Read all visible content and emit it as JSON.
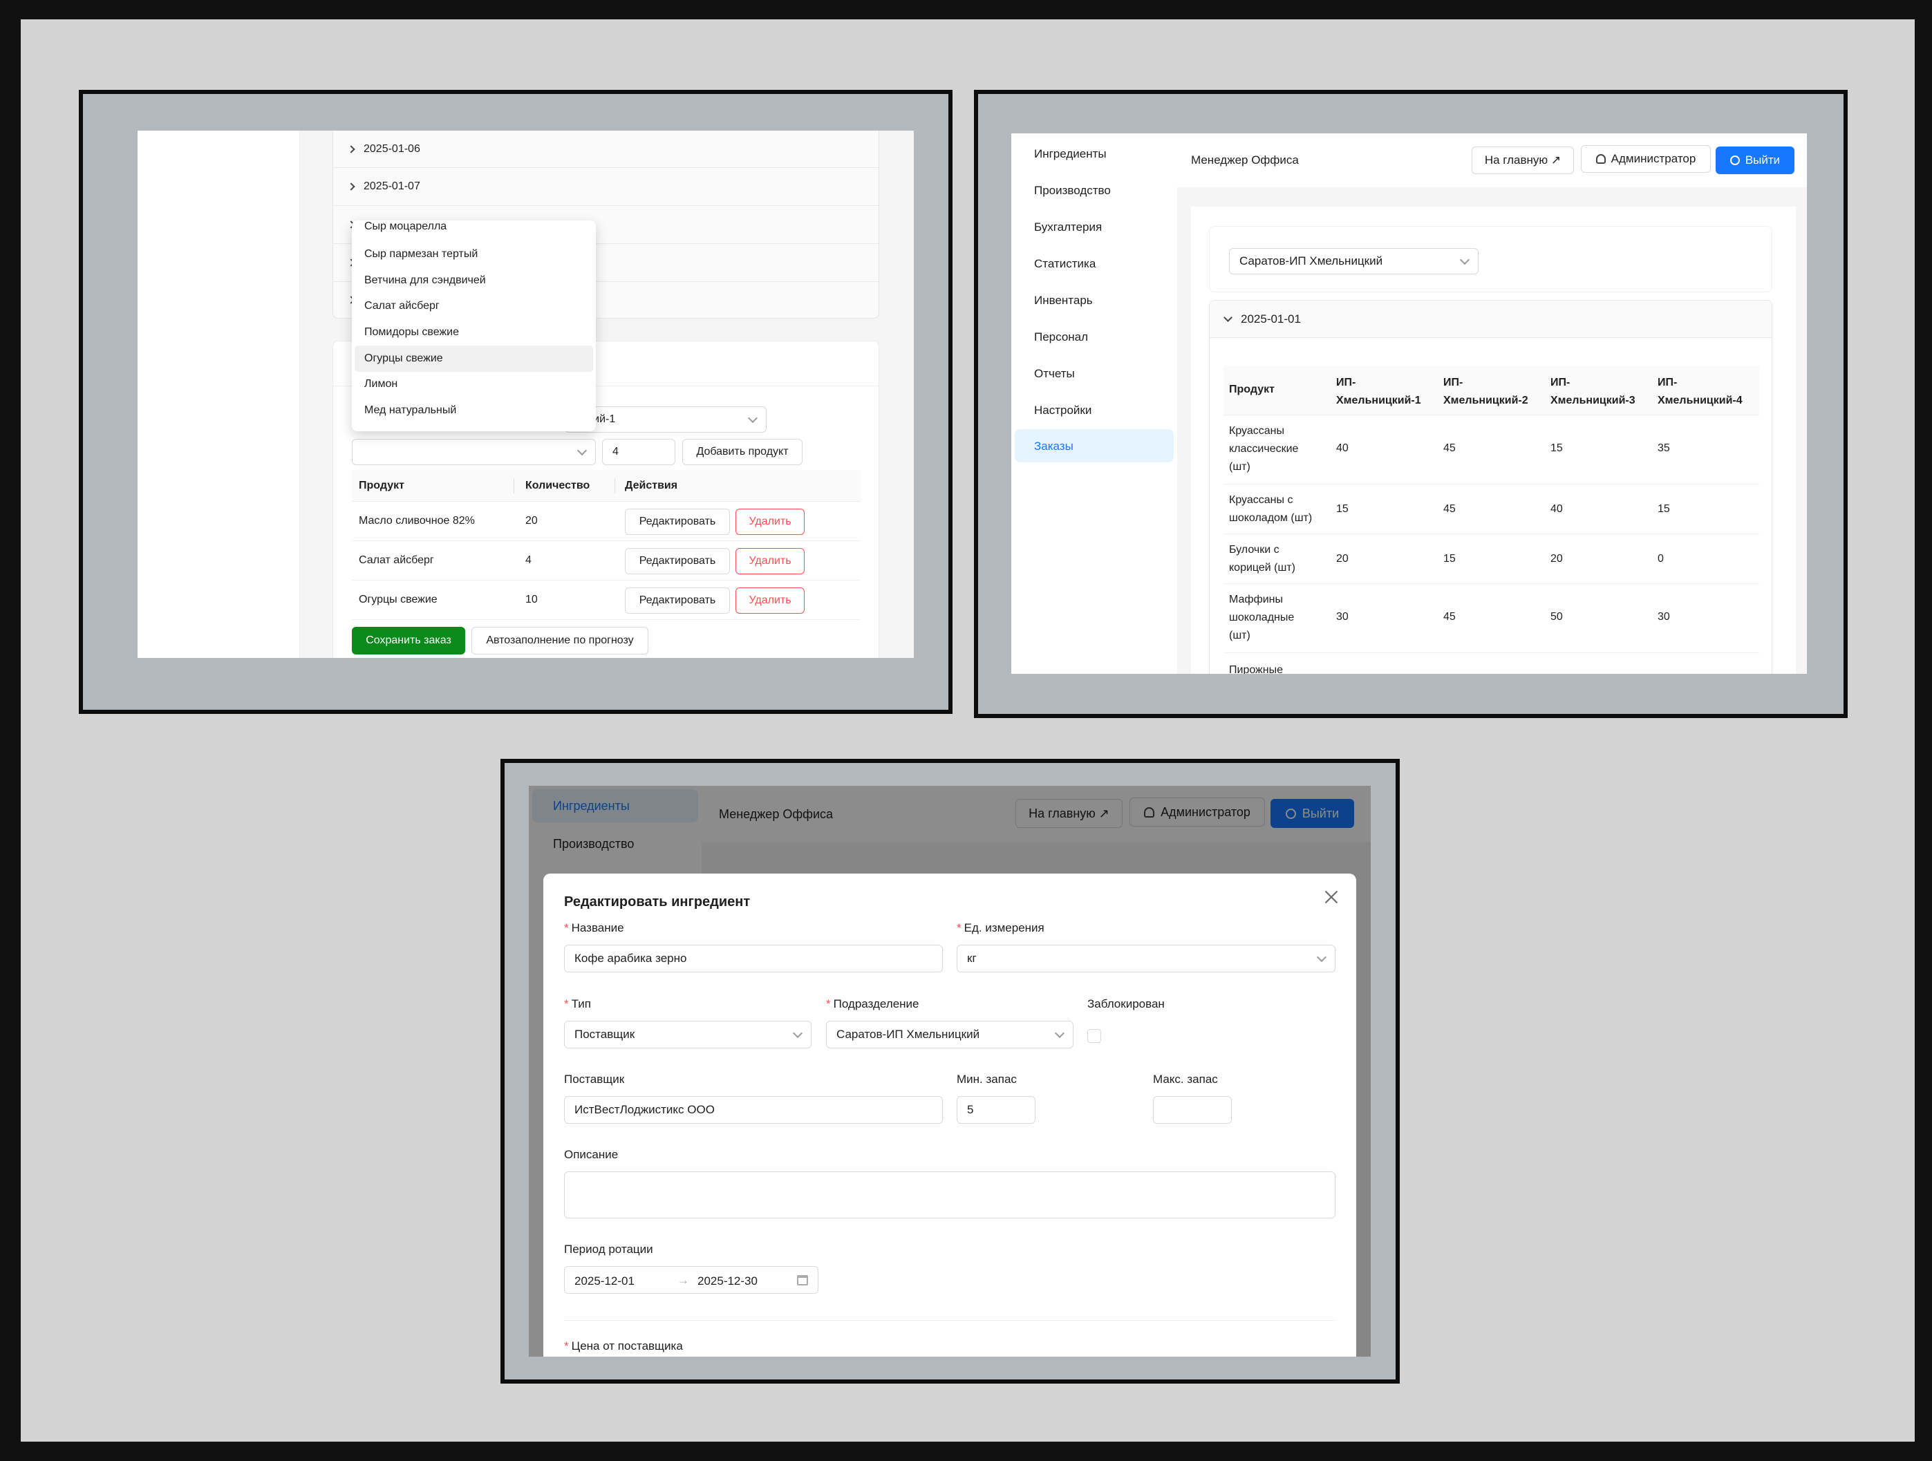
{
  "panel1": {
    "dates": [
      "2025-01-06",
      "2025-01-07"
    ],
    "dropdown_options": [
      "Сыр моцарелла",
      "Сыр пармезан тертый",
      "Ветчина для сэндвичей",
      "Салат айсберг",
      "Помидоры свежие",
      "Огурцы свежие",
      "Лимон",
      "Мед натуральный"
    ],
    "selected_option": "Огурцы свежие",
    "subdivision_value_partial": "цкий-1",
    "quantity_value": "4",
    "add_product_label": "Добавить продукт",
    "table_headers": [
      "Продукт",
      "Количество",
      "Действия"
    ],
    "rows": [
      {
        "product": "Масло сливочное 82%",
        "qty": "20"
      },
      {
        "product": "Салат айсберг",
        "qty": "4"
      },
      {
        "product": "Огурцы свежие",
        "qty": "10"
      }
    ],
    "edit_label": "Редактировать",
    "delete_label": "Удалить",
    "save_order_label": "Сохранить заказ",
    "autofill_label": "Автозаполнение по прогнозу"
  },
  "panel2": {
    "sidebar": [
      "Ингредиенты",
      "Производство",
      "Бухгалтерия",
      "Статистика",
      "Инвентарь",
      "Персонал",
      "Отчеты",
      "Настройки",
      "Заказы"
    ],
    "active_item": "Заказы",
    "header_title": "Менеджер Оффиса",
    "home_label": "На главную ↗",
    "admin_label": "Администратор",
    "logout_label": "Выйти",
    "select_value": "Саратов-ИП Хмельницкий",
    "date": "2025-01-01",
    "table": {
      "headers": [
        "Продукт",
        "ИП-Хмельницкий-1",
        "ИП-Хмельницкий-2",
        "ИП-Хмельницкий-3",
        "ИП-Хмельницкий-4"
      ],
      "rows": [
        {
          "product": "Круассаны классические (шт)",
          "v": [
            "40",
            "45",
            "15",
            "35"
          ]
        },
        {
          "product": "Круассаны с шоколадом (шт)",
          "v": [
            "15",
            "45",
            "40",
            "15"
          ]
        },
        {
          "product": "Булочки с корицей (шт)",
          "v": [
            "20",
            "15",
            "20",
            "0"
          ]
        },
        {
          "product": "Маффины шоколадные (шт)",
          "v": [
            "30",
            "45",
            "50",
            "30"
          ]
        }
      ],
      "partial_row": "Пирожные"
    }
  },
  "panel3": {
    "sidebar": [
      "Ингредиенты",
      "Производство"
    ],
    "header_title": "Менеджер Оффиса",
    "home_label": "На главную ↗",
    "admin_label": "Администратор",
    "logout_label": "Выйти",
    "modal": {
      "title": "Редактировать ингредиент",
      "name_label": "Название",
      "name_value": "Кофе арабика зерно",
      "unit_label": "Ед. измерения",
      "unit_value": "кг",
      "type_label": "Тип",
      "type_value": "Поставщик",
      "division_label": "Подразделение",
      "division_value": "Саратов-ИП Хмельницкий",
      "blocked_label": "Заблокирован",
      "supplier_label": "Поставщик",
      "supplier_value": "ИстВестЛоджистикс ООО",
      "min_label": "Мин. запас",
      "min_value": "5",
      "max_label": "Макс. запас",
      "max_value": "",
      "desc_label": "Описание",
      "desc_value": "",
      "rotation_label": "Период ротации",
      "rotation_from": "2025-12-01",
      "rotation_arrow": "→",
      "rotation_to": "2025-12-30",
      "price_label": "Цена от поставщика"
    }
  }
}
